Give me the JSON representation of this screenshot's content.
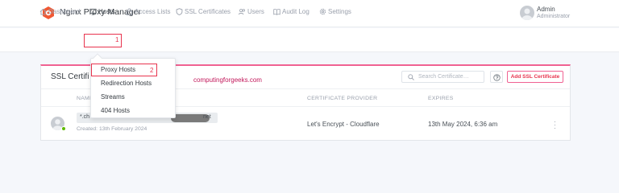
{
  "app": {
    "title": "Nginx Proxy Manager"
  },
  "user": {
    "name": "Admin",
    "role": "Administrator"
  },
  "nav": {
    "items": [
      {
        "label": "Dashboard",
        "icon": "home-icon"
      },
      {
        "label": "Hosts",
        "icon": "monitor-icon"
      },
      {
        "label": "Access Lists",
        "icon": "lock-icon"
      },
      {
        "label": "SSL Certificates",
        "icon": "shield-icon"
      },
      {
        "label": "Users",
        "icon": "users-icon"
      },
      {
        "label": "Audit Log",
        "icon": "book-icon"
      },
      {
        "label": "Settings",
        "icon": "gear-icon"
      }
    ]
  },
  "annotations": {
    "step1": "1",
    "step2": "2"
  },
  "dropdown": {
    "items": [
      "Proxy Hosts",
      "Redirection Hosts",
      "Streams",
      "404 Hosts"
    ]
  },
  "card": {
    "title": "SSL Certifi",
    "watermark": "computingforgeeks.com",
    "search_placeholder": "Search Certificate…",
    "add_button": "Add SSL Certificate"
  },
  "table": {
    "headers": {
      "name": "NAME",
      "provider": "CERTIFICATE PROVIDER",
      "expires": "EXPIRES"
    },
    "rows": [
      {
        "domain_start": "*.ch",
        "domain_end": "net",
        "created": "Created: 13th February 2024",
        "provider": "Let's Encrypt - Cloudflare",
        "expires": "13th May 2024, 6:36 am",
        "status_color": "#5eba00"
      }
    ]
  },
  "colors": {
    "accent": "#e8344e",
    "card_border_top": "#f06292",
    "watermark": "#c2185b"
  }
}
